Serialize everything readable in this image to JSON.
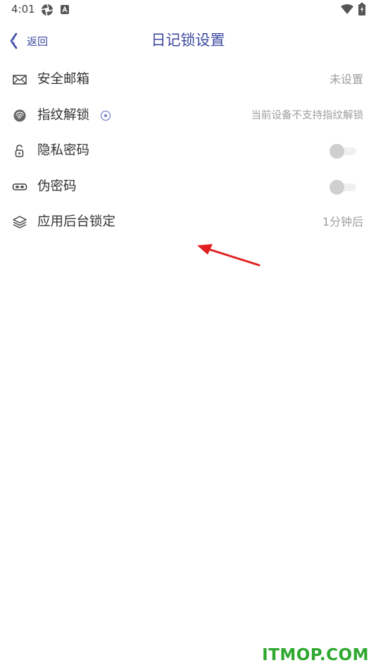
{
  "status_bar": {
    "time": "4:01"
  },
  "header": {
    "back_label": "返回",
    "title": "日记锁设置"
  },
  "settings": [
    {
      "label": "安全邮箱",
      "value": "未设置",
      "icon": "envelope-icon"
    },
    {
      "label": "指纹解锁",
      "value": "当前设备不支持指纹解锁",
      "icon": "fingerprint-icon",
      "has_info": true
    },
    {
      "label": "隐私密码",
      "icon": "lock-icon",
      "toggle": false
    },
    {
      "label": "伪密码",
      "icon": "mask-icon",
      "toggle": false
    },
    {
      "label": "应用后台锁定",
      "value": "1分钟后",
      "icon": "layers-icon"
    }
  ],
  "watermark": "ITMOP.COM",
  "colors": {
    "accent": "#3d4aa0",
    "secondary_text": "#9e9e9e",
    "annotation": "#e02020",
    "watermark": "#2fa82f"
  }
}
